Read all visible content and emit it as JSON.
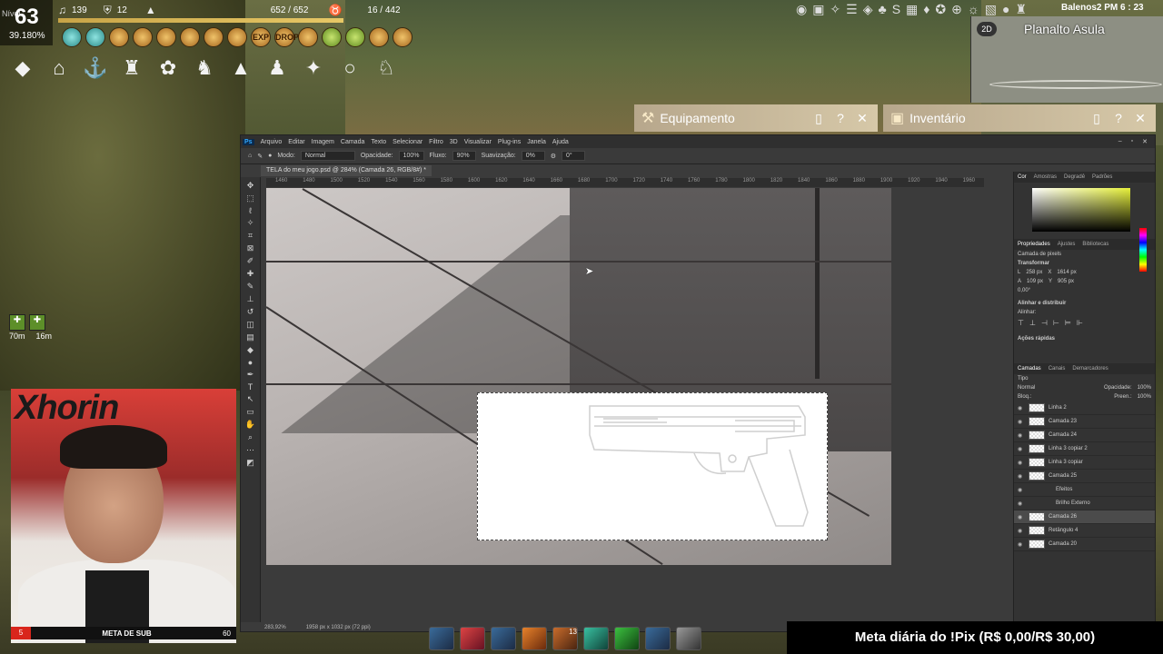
{
  "hud": {
    "level_label": "Nível",
    "level": "63",
    "level_pct": "39.180%",
    "music_count": "139",
    "shield_count": "12",
    "hp": "652 / 652",
    "weight": "16 / 442",
    "hp_fraction": 1.0,
    "row1_icons": [
      "spinner-icon",
      "heart-icon",
      "compass-icon",
      "flame-icon",
      "palette-icon",
      "shop-icon",
      "shield-icon",
      "knight-icon",
      "exp-badge-icon",
      "drop-badge-icon",
      "potion-icon",
      "target-icon",
      "leaf-icon",
      "empty-slot-icon",
      "bag-icon"
    ],
    "row1_labels": [
      "",
      "",
      "",
      "",
      "",
      "",
      "",
      "",
      "EXP",
      "DROP",
      "",
      "",
      "",
      "",
      ""
    ],
    "row2_icons": [
      "shell-icon",
      "home-icon",
      "anchor-icon",
      "castle-icon",
      "paw-icon",
      "horse-head-icon",
      "tent-icon",
      "group-exp-icon",
      "butterfly-icon",
      "empty-icon",
      "horse-icon"
    ],
    "row2_glyphs": [
      "◆",
      "⌂",
      "⚓",
      "♜",
      "✿",
      "♞",
      "▲",
      "♟",
      "✦",
      "○",
      "♘"
    ],
    "buff_times": [
      "70m",
      "16m"
    ]
  },
  "topbar": {
    "server": "Balenos2",
    "time": "PM 6 : 23",
    "top_icons": [
      "◉",
      "▣",
      "✧",
      "☰",
      "◈",
      "♣",
      "S",
      "▦",
      "♦",
      "✪",
      "⊕",
      "☼",
      "▧",
      "●",
      "♜"
    ]
  },
  "minimap": {
    "title": "Planalto Asula",
    "mode": "2D"
  },
  "windows": {
    "equipment": {
      "title": "Equipamento"
    },
    "inventory": {
      "title": "Inventário"
    }
  },
  "photoshop": {
    "menu": [
      "Arquivo",
      "Editar",
      "Imagem",
      "Camada",
      "Texto",
      "Selecionar",
      "Filtro",
      "3D",
      "Visualizar",
      "Plug-ins",
      "Janela",
      "Ajuda"
    ],
    "options": {
      "mode_label": "Modo:",
      "mode": "Normal",
      "opacity_label": "Opacidade:",
      "opacity": "100%",
      "flow_label": "Fluxo:",
      "flow": "90%",
      "smooth_label": "Suavização:",
      "smooth": "0%",
      "angle": "0°"
    },
    "tab_title": "TELA do meu jogo.psd @ 284% (Camada 26, RGB/8#) *",
    "ruler": [
      "1460",
      "1480",
      "1500",
      "1520",
      "1540",
      "1560",
      "1580",
      "1600",
      "1620",
      "1640",
      "1660",
      "1680",
      "1700",
      "1720",
      "1740",
      "1760",
      "1780",
      "1800",
      "1820",
      "1840",
      "1860",
      "1880",
      "1900",
      "1920",
      "1940",
      "1960"
    ],
    "status": {
      "zoom": "283,92%",
      "size": "1958 px x 1032 px (72 ppi)"
    },
    "color_tabs": [
      "Cor",
      "Amostras",
      "Degradê",
      "Padrões"
    ],
    "props_tabs": [
      "Propriedades",
      "Ajustes",
      "Bibliotecas"
    ],
    "props": {
      "kind": "Camada de pixels",
      "transform": "Transformar",
      "L": "258 px",
      "X": "1614 px",
      "A": "109 px",
      "Y": "905 px",
      "angle": "0,00°",
      "align": "Alinhar e distribuir",
      "align_sub": "Alinhar:",
      "quick": "Ações rápidas"
    },
    "layer_tabs": [
      "Camadas",
      "Canais",
      "Demarcadores"
    ],
    "layer_filter": "Tipo",
    "blend": "Normal",
    "opacity_label": "Opacidade:",
    "opacity": "100%",
    "lock_label": "Bloq.:",
    "fill_label": "Preen.:",
    "fill": "100%",
    "layers": [
      "Linha 2",
      "Camada 23",
      "Camada 24",
      "Linha 3 copiar 2",
      "Linha 3 copiar",
      "Camada 25",
      "Efeitos",
      "Brilho Externo",
      "Camada 26",
      "Retângulo 4",
      "Camada 20"
    ]
  },
  "stream": {
    "sub_current": "5",
    "sub_label": "META DE SUB",
    "sub_goal": "60",
    "pix": "Meta diária do !Pix (R$ 0,00/R$ 30,00)",
    "webcam_logo": "Xhorin"
  },
  "skills": {
    "count_label": "13"
  }
}
